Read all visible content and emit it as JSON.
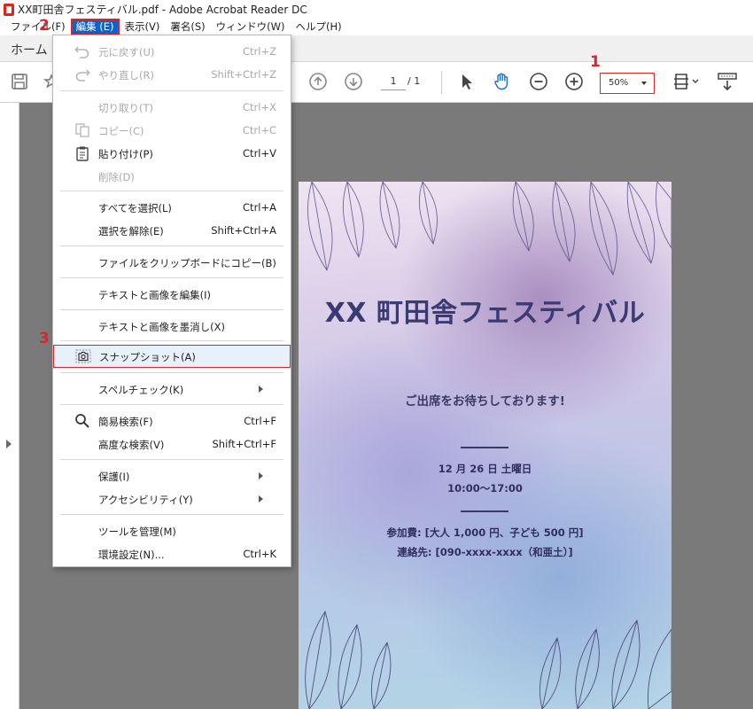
{
  "window": {
    "title": "XX町田舎フェスティバル.pdf - Adobe Acrobat Reader DC"
  },
  "menubar": {
    "items": [
      "ファイル(F)",
      "編集 (E)",
      "表示(V)",
      "署名(S)",
      "ウィンドウ(W)",
      "ヘルプ(H)"
    ]
  },
  "tabs": {
    "home": "ホーム"
  },
  "toolbar": {
    "current_page": "1",
    "page_total": "/ 1",
    "zoom": "50%"
  },
  "dropdown": {
    "items": [
      {
        "label": "元に戻す(U)",
        "shortcut": "Ctrl+Z",
        "icon": "undo-icon"
      },
      {
        "label": "やり直し(R)",
        "shortcut": "Shift+Ctrl+Z",
        "icon": "redo-icon"
      },
      {
        "label": "切り取り(T)",
        "shortcut": "Ctrl+X"
      },
      {
        "label": "コピー(C)",
        "shortcut": "Ctrl+C",
        "icon": "copy-icon"
      },
      {
        "label": "貼り付け(P)",
        "shortcut": "Ctrl+V",
        "icon": "paste-icon"
      },
      {
        "label": "削除(D)",
        "shortcut": ""
      },
      {
        "label": "すべてを選択(L)",
        "shortcut": "Ctrl+A"
      },
      {
        "label": "選択を解除(E)",
        "shortcut": "Shift+Ctrl+A"
      },
      {
        "label": "ファイルをクリップボードにコピー(B)",
        "shortcut": ""
      },
      {
        "label": "テキストと画像を編集(I)",
        "shortcut": ""
      },
      {
        "label": "テキストと画像を墨消し(X)",
        "shortcut": ""
      },
      {
        "label": "スナップショット(A)",
        "shortcut": "",
        "icon": "camera-icon"
      },
      {
        "label": "スペルチェック(K)",
        "shortcut": ""
      },
      {
        "label": "簡易検索(F)",
        "shortcut": "Ctrl+F",
        "icon": "search-icon"
      },
      {
        "label": "高度な検索(V)",
        "shortcut": "Shift+Ctrl+F"
      },
      {
        "label": "保護(I)",
        "shortcut": ""
      },
      {
        "label": "アクセシビリティ(Y)",
        "shortcut": ""
      },
      {
        "label": "ツールを管理(M)",
        "shortcut": ""
      },
      {
        "label": "環境設定(N)...",
        "shortcut": "Ctrl+K"
      }
    ]
  },
  "poster": {
    "heading": "XX 町田舎フェスティバル",
    "invite": "ご出席をお待ちしております!",
    "date": "12 月 26 日 土曜日",
    "time": "10:00〜17:00",
    "fee": "参加費: [大人 1,000 円、子ども 500 円]",
    "contact": "連絡先: [090-xxxx-xxxx（和亜土）]"
  },
  "steps": [
    "1",
    "2",
    "3"
  ],
  "colors": {
    "accent_red": "#d9262c",
    "menu_highlight": "#0a64c9",
    "icon_blue": "#1a6fd0",
    "poster_text": "#3b3a73"
  }
}
